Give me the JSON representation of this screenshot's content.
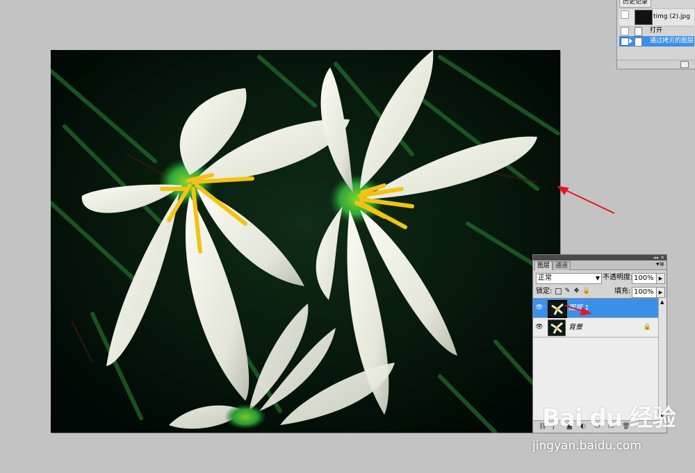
{
  "history_panel": {
    "title": "历史记录",
    "snapshot_label": "timg (2).jpg",
    "steps": [
      {
        "label": "打开",
        "selected": false
      },
      {
        "label": "通过拷贝的图层",
        "selected": true
      }
    ]
  },
  "layers_panel": {
    "tabs": [
      "图层",
      "通道"
    ],
    "active_tab": "图层",
    "blend_mode": "正常",
    "opacity_label": "不透明度:",
    "opacity_value": "100%",
    "lock_label": "锁定:",
    "fill_label": "填充:",
    "fill_value": "100%",
    "layers": [
      {
        "name": "图层 1",
        "selected": true,
        "visible": true,
        "locked": false
      },
      {
        "name": "背景",
        "selected": false,
        "visible": true,
        "locked": true
      }
    ]
  },
  "watermark": {
    "logo": "Bai du 经验",
    "url": "jingyan.baidu.com"
  },
  "colors": {
    "workspace": "#c3c3c3",
    "panel": "#d4d4d4",
    "selection": "#3b8fe8",
    "annotation_arrow": "#e8141c"
  },
  "icons": [
    "eye-icon",
    "lock-icon",
    "link-icon",
    "fx-icon",
    "mask-icon",
    "new-layer-icon",
    "trash-icon",
    "panel-menu-icon"
  ]
}
